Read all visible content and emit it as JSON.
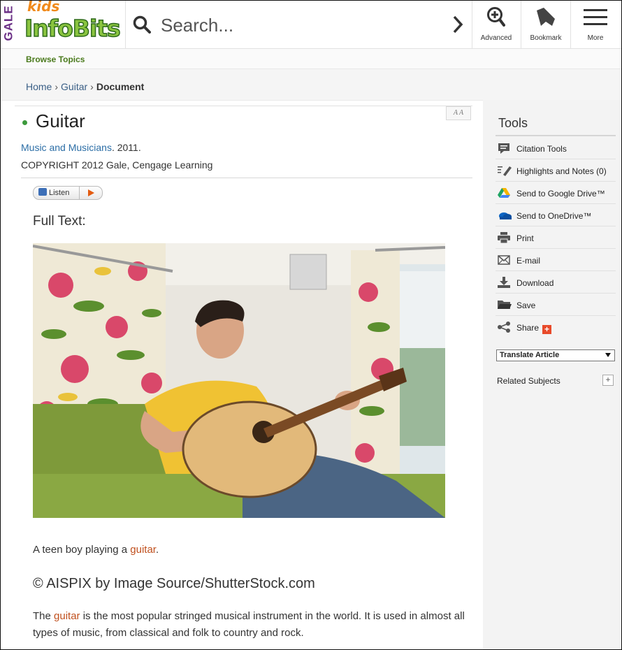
{
  "brand": {
    "gale": "GALE",
    "kids": "kids",
    "product": "InfoBits"
  },
  "search": {
    "placeholder": "Search..."
  },
  "header_buttons": {
    "advanced": "Advanced",
    "bookmark": "Bookmark",
    "more": "More"
  },
  "nav": {
    "browse_topics": "Browse Topics"
  },
  "breadcrumb": {
    "home": "Home",
    "guitar": "Guitar",
    "current": "Document"
  },
  "article": {
    "title": "Guitar",
    "source_title": "Music and Musicians",
    "source_year": ". 2011.",
    "copyright": "COPYRIGHT 2012 Gale, Cengage Learning",
    "listen_label": "Listen",
    "font_size_label": "A A",
    "full_text_label": "Full Text:",
    "caption_pre": "A teen boy playing a ",
    "caption_link": "guitar",
    "caption_post": ".",
    "credit": "© AISPIX by Image Source/ShutterStock.com",
    "para_pre": "The ",
    "para_link": "guitar",
    "para_post": " is the most popular stringed musical instrument in the world. It is used in almost all types of music, from classical and folk to country and rock."
  },
  "sidebar": {
    "tools_title": "Tools",
    "tools": [
      {
        "label": "Citation Tools",
        "icon": "citation-icon"
      },
      {
        "label": "Highlights and Notes (0)",
        "icon": "highlight-pen-icon"
      },
      {
        "label": "Send to Google Drive™",
        "icon": "google-drive-icon"
      },
      {
        "label": "Send to OneDrive™",
        "icon": "onedrive-icon"
      },
      {
        "label": "Print",
        "icon": "printer-icon"
      },
      {
        "label": "E-mail",
        "icon": "email-icon"
      },
      {
        "label": "Download",
        "icon": "download-icon"
      },
      {
        "label": "Save",
        "icon": "folder-icon"
      },
      {
        "label": "Share",
        "icon": "share-icon"
      }
    ],
    "share_plus": "+",
    "translate": "Translate Article",
    "related_subjects": "Related Subjects",
    "related_expand": "+"
  },
  "colors": {
    "brand_green": "#8ac43f",
    "link_blue": "#2c6ea6",
    "link_orange": "#c0501e",
    "gale_purple": "#6a2f85"
  }
}
